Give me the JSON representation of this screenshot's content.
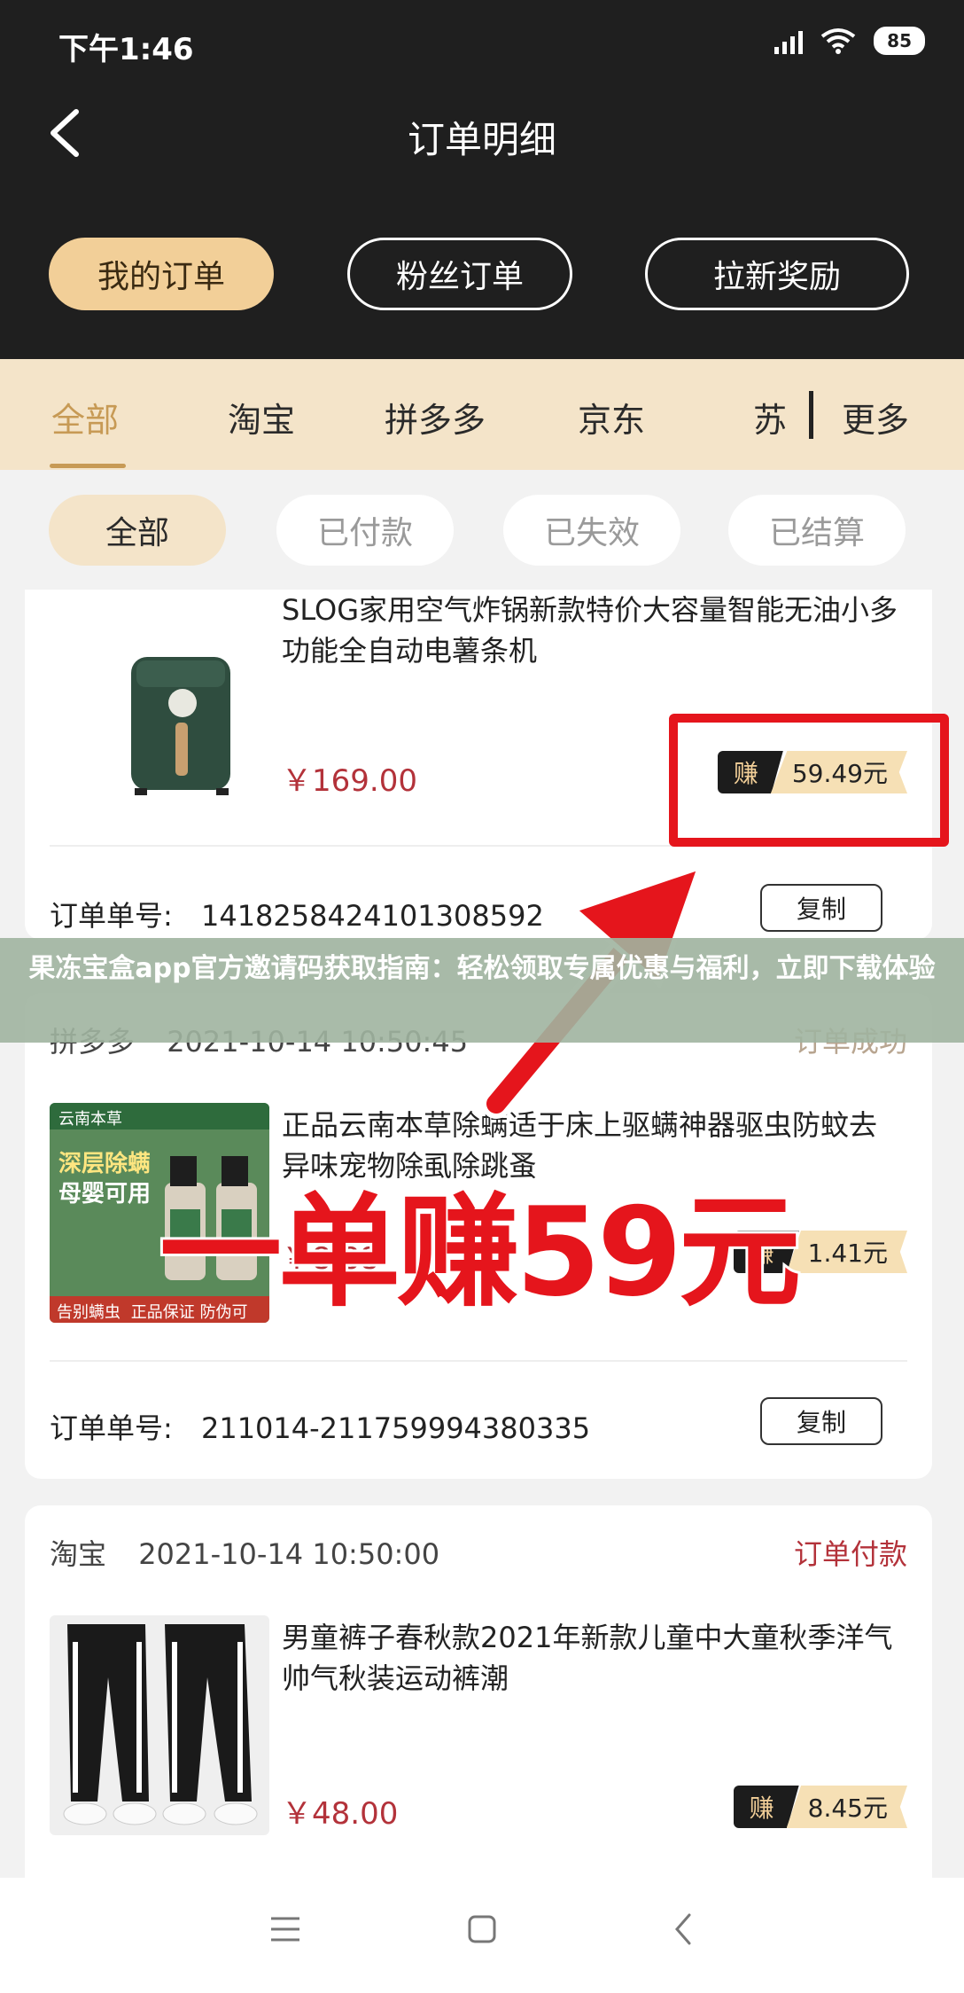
{
  "status_bar": {
    "time": "下午1:46",
    "battery": "85"
  },
  "header": {
    "title": "订单明细",
    "tabs": [
      {
        "label": "我的订单",
        "active": true
      },
      {
        "label": "粉丝订单",
        "active": false
      },
      {
        "label": "拉新奖励",
        "active": false
      }
    ]
  },
  "platforms": {
    "tabs": [
      "全部",
      "淘宝",
      "拼多多",
      "京东",
      "苏"
    ],
    "more": "更多",
    "active": "全部"
  },
  "filters": {
    "chips": [
      "全部",
      "已付款",
      "已失效",
      "已结算"
    ],
    "active": "全部"
  },
  "orders": [
    {
      "platform": "",
      "time": "",
      "status": "",
      "name": "SLOG家用空气炸锅新款特价大容量智能无油小多功能全自动电薯条机",
      "price": "￥169.00",
      "earn_label": "赚",
      "earn_value": "59.49元",
      "order_label": "订单单号:",
      "order_no": "1418258424101308592",
      "copy": "复制"
    },
    {
      "platform": "拼多多",
      "time": "2021-10-14 10:50:45",
      "status": "订单成功",
      "name": "正品云南本草除螨适于床上驱螨神器驱虫防蚊去异味宠物除虱除跳蚤",
      "price": "￥8.88",
      "earn_label": "赚",
      "earn_value": "1.41元",
      "order_label": "订单单号:",
      "order_no": "211014-211759994380335",
      "copy": "复制",
      "img_text": {
        "brand": "云南本草",
        "line1": "深层除螨",
        "line2": "母婴可用",
        "footer": "正品保证 防伪可查",
        "badge": "告别螨虫"
      }
    },
    {
      "platform": "淘宝",
      "time": "2021-10-14 10:50:00",
      "status": "订单付款",
      "name": "男童裤子春秋款2021年新款儿童中大童秋季洋气帅气秋装运动裤潮",
      "price": "￥48.00",
      "earn_label": "赚",
      "earn_value": "8.45元"
    }
  ],
  "overlay": {
    "banner": "果冻宝盒app官方邀请码获取指南：轻松领取专属优惠与福利，立即下载体验",
    "promo": "一单赚59元",
    "accent": "#e5151c"
  },
  "colors": {
    "gold": "#f2cf98",
    "dark": "#1f1f1f",
    "price_red": "#b3323a"
  }
}
